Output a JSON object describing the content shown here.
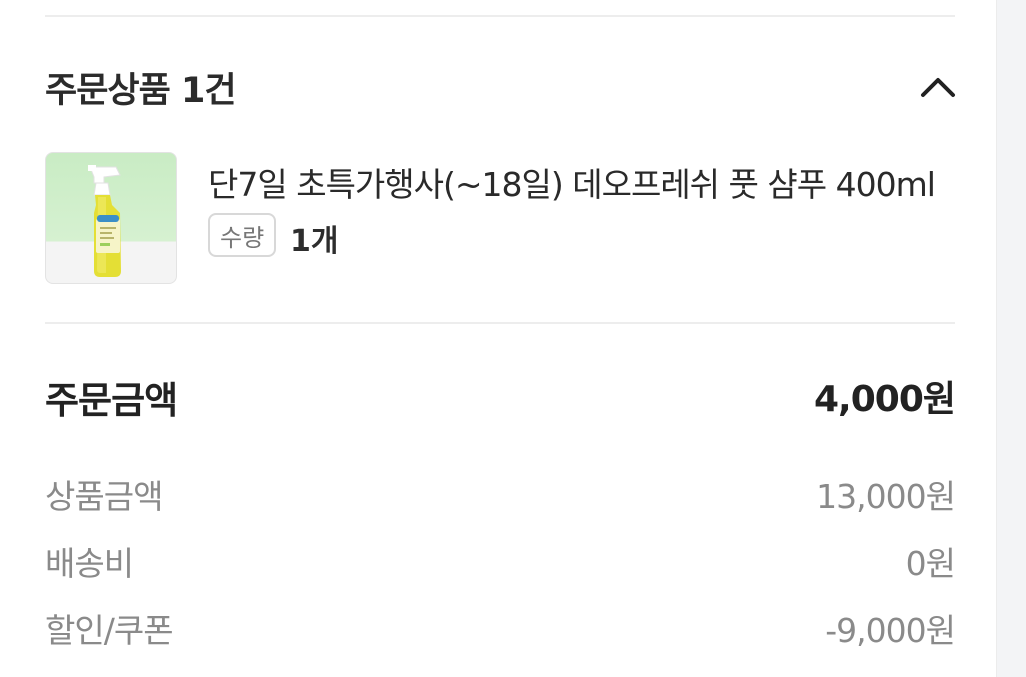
{
  "order_items": {
    "title": "주문상품 1건",
    "collapse_icon": "chevron-up-icon"
  },
  "product": {
    "name": "단7일 초특가행사(~18일) 데오프레쉬 풋 샴푸 400ml",
    "quantity_label": "수량",
    "quantity_value": "1개",
    "image_icon": "product-thumbnail",
    "brand_colors": {
      "background_green": "#c9ecc4",
      "bottle_yellow": "#e7e23a",
      "label_blue": "#3b8fc7"
    }
  },
  "summary": {
    "total_label": "주문금액",
    "total_value": "4,000원",
    "rows": [
      {
        "label": "상품금액",
        "value": "13,000원"
      },
      {
        "label": "배송비",
        "value": "0원"
      },
      {
        "label": "할인/쿠폰",
        "value": "-9,000원"
      }
    ]
  }
}
